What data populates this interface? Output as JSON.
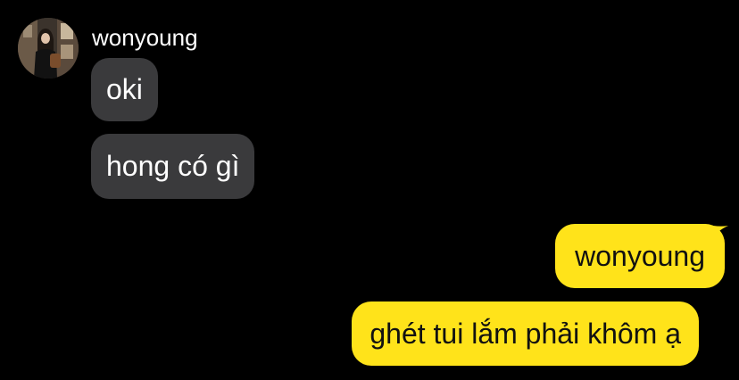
{
  "conversation": {
    "sender_name": "wonyoung",
    "avatar_icon": "profile-photo-avatar"
  },
  "messages": [
    {
      "side": "incoming",
      "text": "oki"
    },
    {
      "side": "incoming",
      "text": "hong có gì"
    },
    {
      "side": "outgoing",
      "text": "wonyoung"
    },
    {
      "side": "outgoing",
      "text": "ghét tui lắm phải khôm ạ"
    }
  ],
  "colors": {
    "background": "#000000",
    "incoming_bubble": "#3a3a3c",
    "outgoing_bubble": "#ffe31a",
    "incoming_text": "#ffffff",
    "outgoing_text": "#111111"
  }
}
